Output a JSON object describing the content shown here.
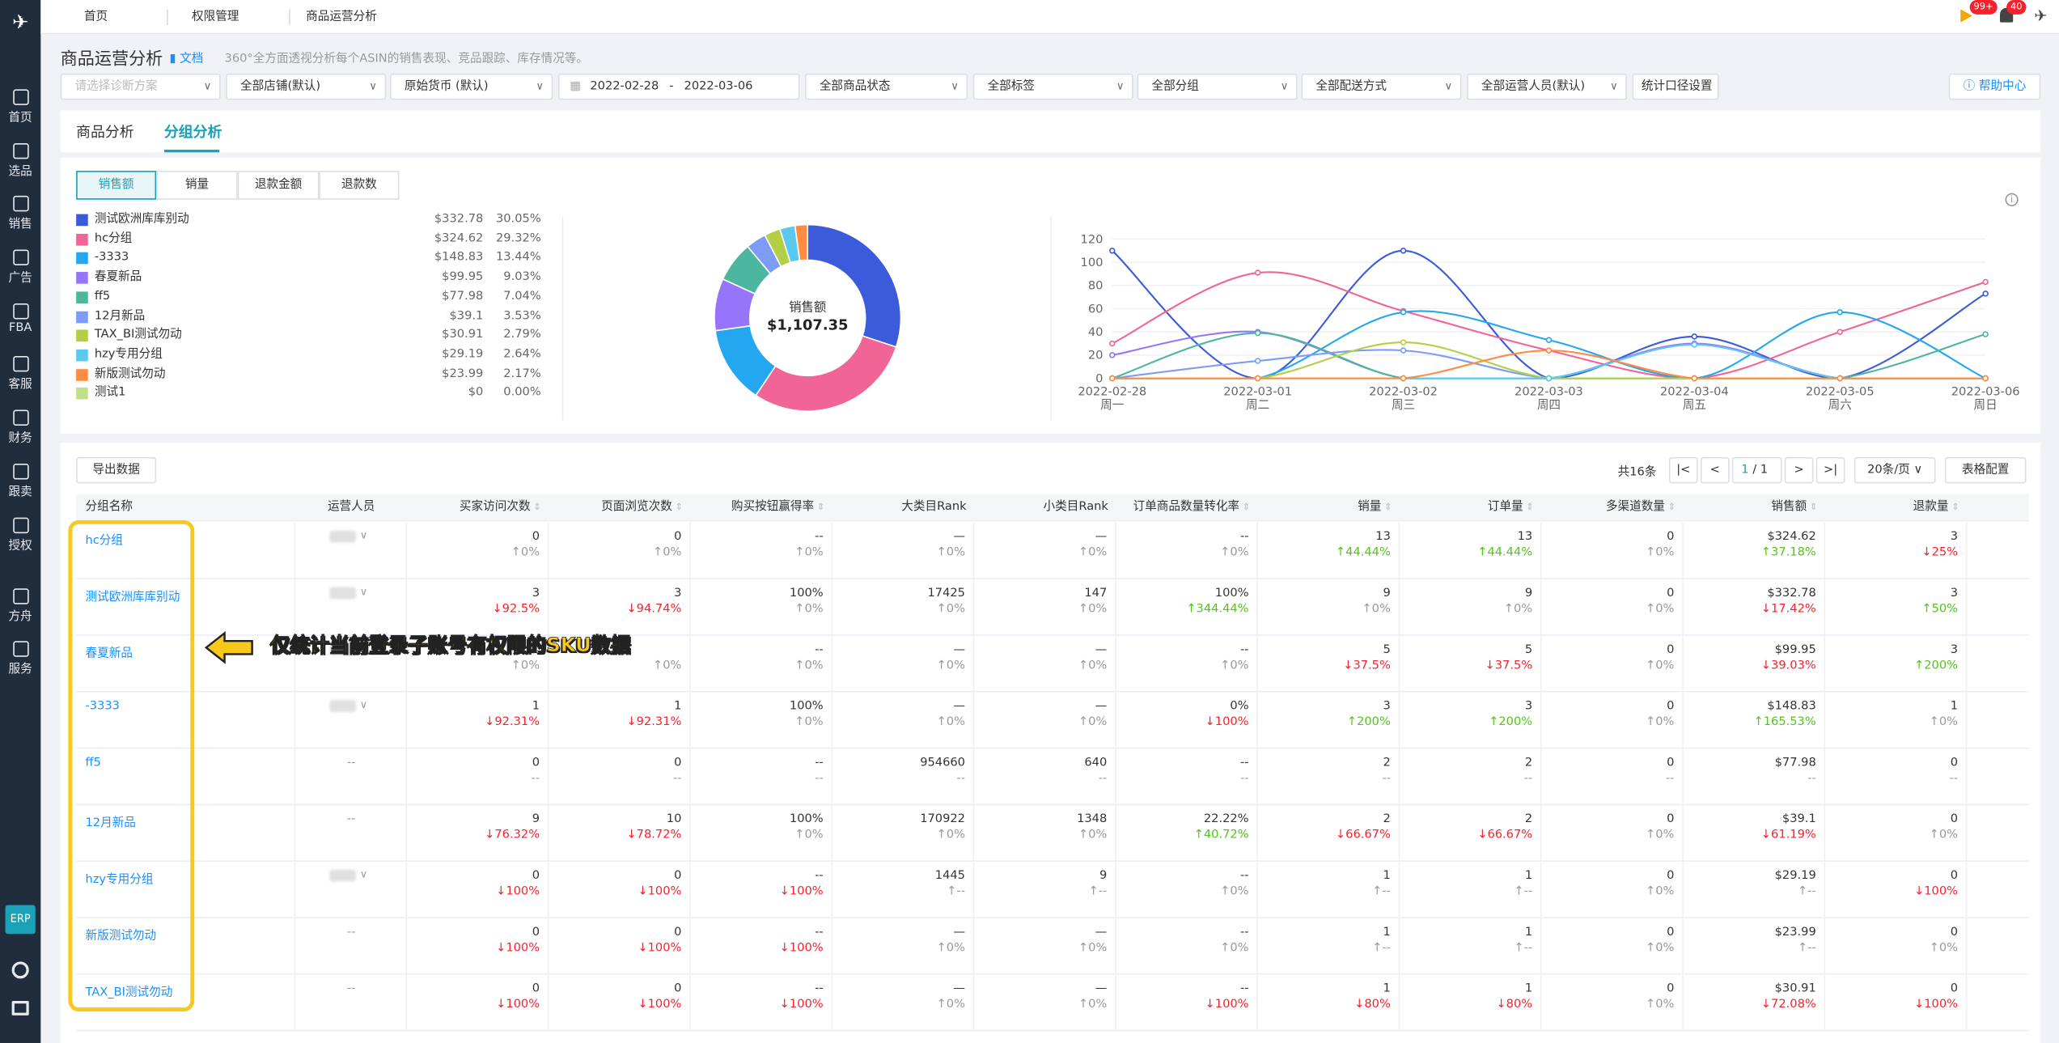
{
  "nav": {
    "items": [
      {
        "icon": "home-icon",
        "label": "首页"
      },
      {
        "icon": "search-icon",
        "label": "选品"
      },
      {
        "icon": "sales-chart-icon",
        "label": "销售"
      },
      {
        "icon": "ad-icon",
        "label": "广告"
      },
      {
        "icon": "fba-icon",
        "label": "FBA"
      },
      {
        "icon": "service-icon",
        "label": "客服"
      },
      {
        "icon": "finance-icon",
        "label": "财务"
      },
      {
        "icon": "follow-icon",
        "label": "跟卖"
      },
      {
        "icon": "auth-icon",
        "label": "授权"
      },
      {
        "icon": "fangzhou-icon",
        "label": "方舟"
      },
      {
        "icon": "services-icon",
        "label": "服务"
      }
    ],
    "erp": "ERP"
  },
  "topbar": {
    "tabs": [
      "首页",
      "权限管理",
      "商品运营分析"
    ],
    "badge_flag": "99+",
    "badge_bell": "40"
  },
  "header": {
    "title": "商品运营分析",
    "doc": "文档",
    "subtitle": "360°全方面透视分析每个ASIN的销售表现、竞品跟踪、库存情况等。"
  },
  "filters": {
    "scheme_placeholder": "请选择诊断方案",
    "shop": "全部店铺(默认)",
    "currency": "原始货币 (默认)",
    "date_start": "2022-02-28",
    "date_sep": "-",
    "date_end": "2022-03-06",
    "status": "全部商品状态",
    "tags": "全部标签",
    "group": "全部分组",
    "delivery": "全部配送方式",
    "operator": "全部运营人员(默认)",
    "stat_setting": "统计口径设置",
    "help": "帮助中心"
  },
  "page_tabs": [
    "商品分析",
    "分组分析"
  ],
  "metric_tabs": [
    "销售额",
    "销量",
    "退款金额",
    "退款数"
  ],
  "legend": [
    {
      "name": "测试欧洲库库别动",
      "value": "$332.78",
      "pct": "30.05%",
      "color": "#3b5bdb"
    },
    {
      "name": "hc分组",
      "value": "$324.62",
      "pct": "29.32%",
      "color": "#f06595"
    },
    {
      "name": "-3333",
      "value": "$148.83",
      "pct": "13.44%",
      "color": "#22a7f0"
    },
    {
      "name": "春夏新品",
      "value": "$99.95",
      "pct": "9.03%",
      "color": "#9775fa"
    },
    {
      "name": "ff5",
      "value": "$77.98",
      "pct": "7.04%",
      "color": "#4db6a0"
    },
    {
      "name": "12月新品",
      "value": "$39.1",
      "pct": "3.53%",
      "color": "#7c9cf5"
    },
    {
      "name": "TAX_BI测试勿动",
      "value": "$30.91",
      "pct": "2.79%",
      "color": "#b5cf45"
    },
    {
      "name": "hzy专用分组",
      "value": "$29.19",
      "pct": "2.64%",
      "color": "#5bc8f0"
    },
    {
      "name": "新版测试勿动",
      "value": "$23.99",
      "pct": "2.17%",
      "color": "#ff8c42"
    },
    {
      "name": "测试1",
      "value": "$0",
      "pct": "0.00%",
      "color": "#c0e08a"
    }
  ],
  "chart_data": [
    {
      "type": "pie",
      "title": "销售额",
      "total": "$1,107.35",
      "categories": [
        "测试欧洲库库别动",
        "hc分组",
        "-3333",
        "春夏新品",
        "ff5",
        "12月新品",
        "TAX_BI测试勿动",
        "hzy专用分组",
        "新版测试勿动",
        "测试1"
      ],
      "values": [
        332.78,
        324.62,
        148.83,
        99.95,
        77.98,
        39.1,
        30.91,
        29.19,
        23.99,
        0
      ]
    },
    {
      "type": "line",
      "x": [
        "2022-02-28",
        "2022-03-01",
        "2022-03-02",
        "2022-03-03",
        "2022-03-04",
        "2022-03-05",
        "2022-03-06"
      ],
      "x_sub": [
        "周一",
        "周二",
        "周三",
        "周四",
        "周五",
        "周六",
        "周日"
      ],
      "ylim": [
        0,
        120
      ],
      "yticks": [
        0,
        20,
        40,
        60,
        80,
        100,
        120
      ],
      "series": [
        {
          "name": "测试欧洲库库别动",
          "color": "#3b5bdb",
          "values": [
            110,
            0,
            110,
            0,
            36,
            0,
            73
          ]
        },
        {
          "name": "hc分组",
          "color": "#f06595",
          "values": [
            30,
            91,
            58,
            24,
            0,
            40,
            83
          ]
        },
        {
          "name": "-3333",
          "color": "#22a7f0",
          "values": [
            0,
            0,
            57,
            33,
            0,
            57,
            0
          ]
        },
        {
          "name": "春夏新品",
          "color": "#9775fa",
          "values": [
            20,
            40,
            0,
            0,
            30,
            0,
            0
          ]
        },
        {
          "name": "ff5",
          "color": "#4db6a0",
          "values": [
            0,
            39,
            0,
            0,
            0,
            0,
            38
          ]
        },
        {
          "name": "12月新品",
          "color": "#7c9cf5",
          "values": [
            0,
            15,
            24,
            0,
            0,
            0,
            0
          ]
        },
        {
          "name": "TAX_BI测试勿动",
          "color": "#b5cf45",
          "values": [
            0,
            0,
            31,
            0,
            0,
            0,
            0
          ]
        },
        {
          "name": "hzy专用分组",
          "color": "#5bc8f0",
          "values": [
            0,
            0,
            0,
            0,
            29,
            0,
            0
          ]
        },
        {
          "name": "新版测试勿动",
          "color": "#ff8c42",
          "values": [
            0,
            0,
            0,
            24,
            0,
            0,
            0
          ]
        }
      ]
    }
  ],
  "table": {
    "export": "导出数据",
    "total": "共16条",
    "page": "1",
    "page_total": "/ 1",
    "page_size": "20条/页",
    "config": "表格配置",
    "headers": [
      "分组名称",
      "运营人员",
      "买家访问次数",
      "页面浏览次数",
      "购买按钮赢得率",
      "大类目Rank",
      "小类目Rank",
      "订单商品数量转化率",
      "销量",
      "订单量",
      "多渠道数量",
      "销售额",
      "退款量"
    ],
    "rows": [
      {
        "name": "hc分组",
        "op": "blur",
        "cells": [
          [
            "0",
            "↑0%",
            "g"
          ],
          [
            "0",
            "↑0%",
            "g"
          ],
          [
            "--",
            "↑0%",
            "g"
          ],
          [
            "—",
            "↑0%",
            "g"
          ],
          [
            "—",
            "↑0%",
            "g"
          ],
          [
            "--",
            "↑0%",
            "g"
          ],
          [
            "13",
            "↑44.44%",
            "green"
          ],
          [
            "13",
            "↑44.44%",
            "green"
          ],
          [
            "0",
            "↑0%",
            "g"
          ],
          [
            "$324.62",
            "↑37.18%",
            "green"
          ],
          [
            "3",
            "↓25%",
            "red"
          ]
        ]
      },
      {
        "name": "测试欧洲库库别动",
        "op": "blur",
        "cells": [
          [
            "3",
            "↓92.5%",
            "red"
          ],
          [
            "3",
            "↓94.74%",
            "red"
          ],
          [
            "100%",
            "↑0%",
            "g"
          ],
          [
            "17425",
            "↑0%",
            "g"
          ],
          [
            "147",
            "↑0%",
            "g"
          ],
          [
            "100%",
            "↑344.44%",
            "green"
          ],
          [
            "9",
            "↑0%",
            "g"
          ],
          [
            "9",
            "↑0%",
            "g"
          ],
          [
            "0",
            "↑0%",
            "g"
          ],
          [
            "$332.78",
            "↓17.42%",
            "red"
          ],
          [
            "3",
            "↑50%",
            "green"
          ]
        ]
      },
      {
        "name": "春夏新品",
        "op": "blur",
        "cells": [
          [
            "",
            "↑0%",
            "g"
          ],
          [
            "",
            "↑0%",
            "g"
          ],
          [
            "--",
            "↑0%",
            "g"
          ],
          [
            "—",
            "↑0%",
            "g"
          ],
          [
            "—",
            "↑0%",
            "g"
          ],
          [
            "--",
            "↑0%",
            "g"
          ],
          [
            "5",
            "↓37.5%",
            "red"
          ],
          [
            "5",
            "↓37.5%",
            "red"
          ],
          [
            "0",
            "↑0%",
            "g"
          ],
          [
            "$99.95",
            "↓39.03%",
            "red"
          ],
          [
            "3",
            "↑200%",
            "green"
          ]
        ]
      },
      {
        "name": "-3333",
        "op": "blur",
        "cells": [
          [
            "1",
            "↓92.31%",
            "red"
          ],
          [
            "1",
            "↓92.31%",
            "red"
          ],
          [
            "100%",
            "↑0%",
            "g"
          ],
          [
            "—",
            "↑0%",
            "g"
          ],
          [
            "—",
            "↑0%",
            "g"
          ],
          [
            "0%",
            "↓100%",
            "red"
          ],
          [
            "3",
            "↑200%",
            "green"
          ],
          [
            "3",
            "↑200%",
            "green"
          ],
          [
            "0",
            "↑0%",
            "g"
          ],
          [
            "$148.83",
            "↑165.53%",
            "green"
          ],
          [
            "1",
            "↑0%",
            "g"
          ]
        ]
      },
      {
        "name": "ff5",
        "op": "--",
        "cells": [
          [
            "0",
            "--",
            "g"
          ],
          [
            "0",
            "--",
            "g"
          ],
          [
            "--",
            "--",
            "g"
          ],
          [
            "954660",
            "--",
            "g"
          ],
          [
            "640",
            "--",
            "g"
          ],
          [
            "--",
            "--",
            "g"
          ],
          [
            "2",
            "--",
            "g"
          ],
          [
            "2",
            "--",
            "g"
          ],
          [
            "0",
            "--",
            "g"
          ],
          [
            "$77.98",
            "--",
            "g"
          ],
          [
            "0",
            "--",
            "g"
          ]
        ]
      },
      {
        "name": "12月新品",
        "op": "--",
        "cells": [
          [
            "9",
            "↓76.32%",
            "red"
          ],
          [
            "10",
            "↓78.72%",
            "red"
          ],
          [
            "100%",
            "↑0%",
            "g"
          ],
          [
            "170922",
            "↑0%",
            "g"
          ],
          [
            "1348",
            "↑0%",
            "g"
          ],
          [
            "22.22%",
            "↑40.72%",
            "green"
          ],
          [
            "2",
            "↓66.67%",
            "red"
          ],
          [
            "2",
            "↓66.67%",
            "red"
          ],
          [
            "0",
            "↑0%",
            "g"
          ],
          [
            "$39.1",
            "↓61.19%",
            "red"
          ],
          [
            "0",
            "↑0%",
            "g"
          ]
        ]
      },
      {
        "name": "hzy专用分组",
        "op": "blur",
        "cells": [
          [
            "0",
            "↓100%",
            "red"
          ],
          [
            "0",
            "↓100%",
            "red"
          ],
          [
            "--",
            "↓100%",
            "red"
          ],
          [
            "1445",
            "↑--",
            "g"
          ],
          [
            "9",
            "↑--",
            "g"
          ],
          [
            "--",
            "↑0%",
            "g"
          ],
          [
            "1",
            "↑--",
            "g"
          ],
          [
            "1",
            "↑--",
            "g"
          ],
          [
            "0",
            "↑0%",
            "g"
          ],
          [
            "$29.19",
            "↑--",
            "g"
          ],
          [
            "0",
            "↓100%",
            "red"
          ]
        ]
      },
      {
        "name": "新版测试勿动",
        "op": "--",
        "cells": [
          [
            "0",
            "↓100%",
            "red"
          ],
          [
            "0",
            "↓100%",
            "red"
          ],
          [
            "--",
            "↓100%",
            "red"
          ],
          [
            "—",
            "↑0%",
            "g"
          ],
          [
            "—",
            "↑0%",
            "g"
          ],
          [
            "--",
            "↑0%",
            "g"
          ],
          [
            "1",
            "↑--",
            "g"
          ],
          [
            "1",
            "↑--",
            "g"
          ],
          [
            "0",
            "↑0%",
            "g"
          ],
          [
            "$23.99",
            "↑--",
            "g"
          ],
          [
            "0",
            "↑0%",
            "g"
          ]
        ]
      },
      {
        "name": "TAX_BI测试勿动",
        "op": "--",
        "cells": [
          [
            "0",
            "↓100%",
            "red"
          ],
          [
            "0",
            "↓100%",
            "red"
          ],
          [
            "--",
            "↓100%",
            "red"
          ],
          [
            "—",
            "↑0%",
            "g"
          ],
          [
            "—",
            "↑0%",
            "g"
          ],
          [
            "--",
            "↓100%",
            "red"
          ],
          [
            "1",
            "↓80%",
            "red"
          ],
          [
            "1",
            "↓80%",
            "red"
          ],
          [
            "0",
            "↑0%",
            "g"
          ],
          [
            "$30.91",
            "↓72.08%",
            "red"
          ],
          [
            "0",
            "↓100%",
            "red"
          ]
        ]
      }
    ]
  },
  "callout": "仅统计当前登录子账号有权限的SKU数据"
}
